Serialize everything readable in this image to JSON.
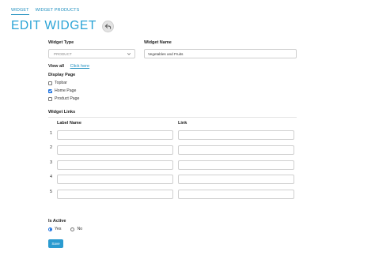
{
  "tabs": [
    {
      "label": "WIDGET",
      "active": true
    },
    {
      "label": "WIDGET PRODUCTS",
      "active": false
    }
  ],
  "page_title": "EDIT WIDGET",
  "back_icon": "back-arrow-icon",
  "form": {
    "widget_type_label": "Widget Type",
    "widget_type_value": "PRODUCT",
    "widget_name_label": "Widget Name",
    "widget_name_value": "Vegetables and Fruits",
    "view_all_label": "View all",
    "view_all_link": "Click here",
    "display_page_label": "Display Page",
    "display_pages": [
      {
        "label": "Topbar",
        "checked": false
      },
      {
        "label": "Home Page",
        "checked": true
      },
      {
        "label": "Product Page",
        "checked": false
      }
    ],
    "widget_links_label": "Widget Links",
    "col_label_name": "Label Name",
    "col_link": "Link",
    "rows": [
      {
        "num": "1",
        "label": "",
        "link": ""
      },
      {
        "num": "2",
        "label": "",
        "link": ""
      },
      {
        "num": "3",
        "label": "",
        "link": ""
      },
      {
        "num": "4",
        "label": "",
        "link": ""
      },
      {
        "num": "5",
        "label": "",
        "link": ""
      }
    ],
    "is_active_label": "Is Active",
    "active_options": [
      {
        "label": "Yes",
        "selected": true
      },
      {
        "label": "No",
        "selected": false
      }
    ],
    "save_label": "Save"
  },
  "colors": {
    "accent": "#29a3d6",
    "link": "#1f8fbf",
    "button": "#2b9bd0",
    "checked": "#1f73e0"
  }
}
